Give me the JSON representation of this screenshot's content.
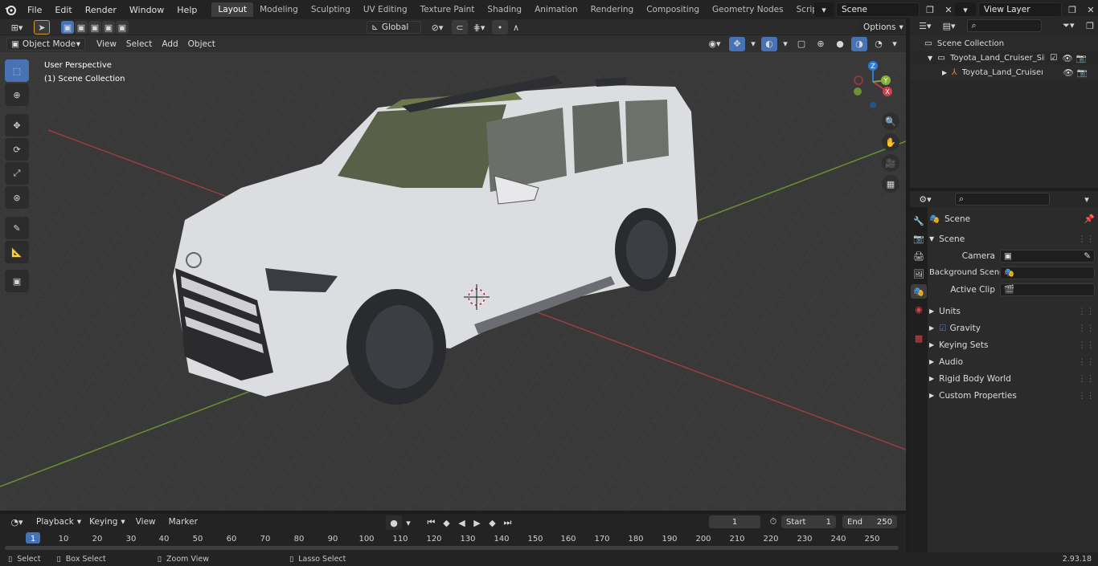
{
  "topbar": {
    "menus": [
      "File",
      "Edit",
      "Render",
      "Window",
      "Help"
    ],
    "workspaces": [
      "Layout",
      "Modeling",
      "Sculpting",
      "UV Editing",
      "Texture Paint",
      "Shading",
      "Animation",
      "Rendering",
      "Compositing",
      "Geometry Nodes",
      "Scripting"
    ],
    "active_workspace": "Layout",
    "scene_name": "Scene",
    "view_layer": "View Layer"
  },
  "toolheader": {
    "orientation": "Global",
    "options_label": "Options"
  },
  "viewport": {
    "mode": "Object Mode",
    "menus": [
      "View",
      "Select",
      "Add",
      "Object"
    ],
    "overlay_title": "User Perspective",
    "overlay_collection": "(1) Scene Collection",
    "gizmo_axes": {
      "x": "X",
      "y": "Y",
      "z": "Z"
    }
  },
  "outliner": {
    "root": "Scene Collection",
    "items": [
      {
        "label": "Toyota_Land_Cruiser_Silver_S"
      },
      {
        "label": "Toyota_Land_Cruiser_Silv"
      }
    ]
  },
  "properties": {
    "context": "Scene",
    "panel_title": "Scene",
    "fields": [
      {
        "label": "Camera"
      },
      {
        "label": "Background Scene"
      },
      {
        "label": "Active Clip"
      }
    ],
    "subpanels": [
      "Units",
      "Gravity",
      "Keying Sets",
      "Audio",
      "Rigid Body World",
      "Custom Properties"
    ]
  },
  "timeline": {
    "menus": [
      "Playback",
      "Keying",
      "View",
      "Marker"
    ],
    "current_frame": "1",
    "start_label": "Start",
    "start_value": "1",
    "end_label": "End",
    "end_value": "250",
    "ticks": [
      "1",
      "10",
      "20",
      "30",
      "40",
      "50",
      "60",
      "70",
      "80",
      "90",
      "100",
      "110",
      "120",
      "130",
      "140",
      "150",
      "160",
      "170",
      "180",
      "190",
      "200",
      "210",
      "220",
      "230",
      "240",
      "250"
    ]
  },
  "statusbar": {
    "items": [
      "Select",
      "Box Select",
      "Zoom View",
      "Lasso Select"
    ],
    "version": "2.93.18"
  },
  "colors": {
    "accent": "#4772b3",
    "x_axis": "#b33b45",
    "y_axis": "#7ea53a",
    "z_axis": "#2d7bd6"
  }
}
